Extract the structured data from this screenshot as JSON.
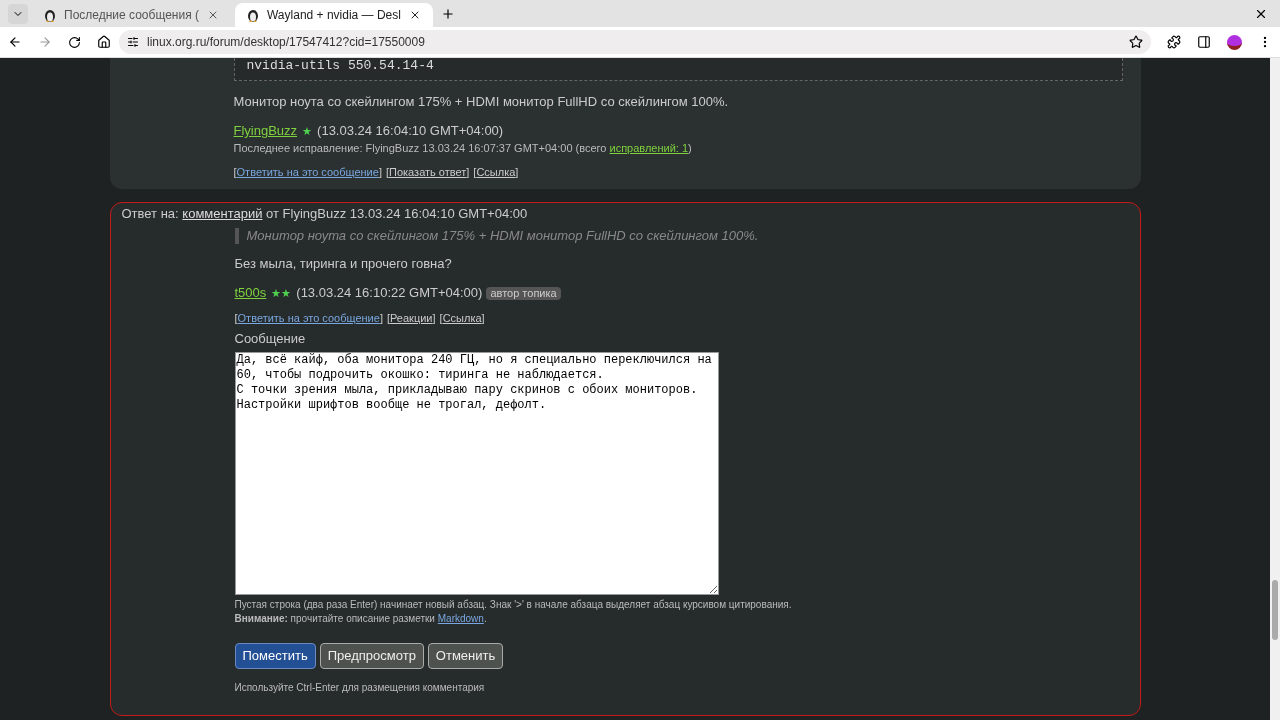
{
  "browser": {
    "tabs": [
      {
        "title": "Последние сообщения (",
        "selected": false
      },
      {
        "title": "Wayland + nvidia — Desl",
        "selected": true
      }
    ],
    "url": "linux.org.ru/forum/desktop/17547412?cid=17550009"
  },
  "previous_comment": {
    "code_tail": "nvidia-utils 550.54.14-4",
    "text": "Монитор ноута со скейлингом 175% + HDMI монитор FullHD со скейлингом 100%.",
    "author": "FlyingBuzz",
    "rank": "★",
    "date": "(13.03.24 16:04:10 GMT+04:00)",
    "edit_prefix": "Последнее исправление: FlyingBuzz 13.03.24 16:07:37 GMT+04:00 (всего ",
    "edit_link": "исправлений: 1",
    "edit_suffix": ")",
    "links": [
      {
        "open": "[",
        "label": "Ответить на это сообщение",
        "close": "]"
      },
      {
        "open": "[",
        "label": "Показать ответ",
        "close": "]"
      },
      {
        "open": "[",
        "label": "Ссылка",
        "close": "]"
      }
    ]
  },
  "reply": {
    "header_prefix": "Ответ на:",
    "header_link": "комментарий",
    "header_suffix": "от FlyingBuzz 13.03.24 16:04:10 GMT+04:00",
    "quote": "Монитор ноута со скейлингом 175% + HDMI монитор FullHD со скейлингом 100%.",
    "text": "Без мыла, тиринга и прочего говна?",
    "author": "t500s",
    "rank": "★★",
    "date": "(13.03.24 16:10:22 GMT+04:00)",
    "badge": "автор топика",
    "links": [
      {
        "open": "[",
        "label": "Ответить на это сообщение",
        "close": "]"
      },
      {
        "open": "[",
        "label": "Реакции",
        "close": "]"
      },
      {
        "open": "[",
        "label": "Ссылка",
        "close": "]"
      }
    ]
  },
  "form": {
    "label": "Сообщение",
    "value": "Да, всё кайф, оба монитора 240 ГЦ, но я специально переключился на 60, чтобы подрочить окошко: тиринга не наблюдается.\nС точки зрения мыла, прикладываю пару скринов с обоих мониторов.\nНастройки шрифтов вообще не трогал, дефолт.",
    "hint": "Пустая строка (два раза Enter) начинает новый абзац. Знак '>' в начале абзаца выделяет абзац курсивом цитирования.",
    "warning": "**Внимание:** прочитайте описание разметки",
    "warning_link": "Markdown",
    "warning_end": ".",
    "buttons": [
      {
        "label": "Поместить",
        "kind": "primary"
      },
      {
        "label": "Предпросмотр",
        "kind": "secondary"
      },
      {
        "label": "Отменить",
        "kind": "secondary"
      }
    ],
    "footer": "Используйте Ctrl-Enter для размещения комментария"
  }
}
